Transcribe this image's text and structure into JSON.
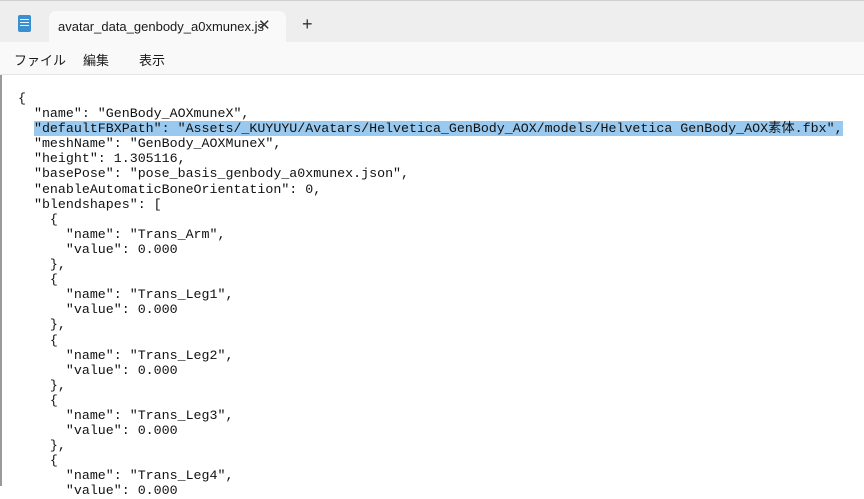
{
  "window": {
    "tab_title": "avatar_data_genbody_a0xmunex.js",
    "new_tab": "+",
    "close_tab": "✕"
  },
  "menu": [
    "ファイル",
    "編集",
    "表示"
  ],
  "editor": {
    "selected_line": 2,
    "lines": [
      "{",
      "  \"name\": \"GenBody_AOXmuneX\",",
      "  \"defaultFBXPath\": \"Assets/_KUYUYU/Avatars/Helvetica_GenBody_AOX/models/Helvetica GenBody_AOX素体.fbx\",",
      "  \"meshName\": \"GenBody_AOXMuneX\",",
      "  \"height\": 1.305116,",
      "  \"basePose\": \"pose_basis_genbody_a0xmunex.json\",",
      "  \"enableAutomaticBoneOrientation\": 0,",
      "  \"blendshapes\": [",
      "    {",
      "      \"name\": \"Trans_Arm\",",
      "      \"value\": 0.000",
      "    },",
      "    {",
      "      \"name\": \"Trans_Leg1\",",
      "      \"value\": 0.000",
      "    },",
      "    {",
      "      \"name\": \"Trans_Leg2\",",
      "      \"value\": 0.000",
      "    },",
      "    {",
      "      \"name\": \"Trans_Leg3\",",
      "      \"value\": 0.000",
      "    },",
      "    {",
      "      \"name\": \"Trans_Leg4\",",
      "      \"value\": 0.000"
    ]
  }
}
